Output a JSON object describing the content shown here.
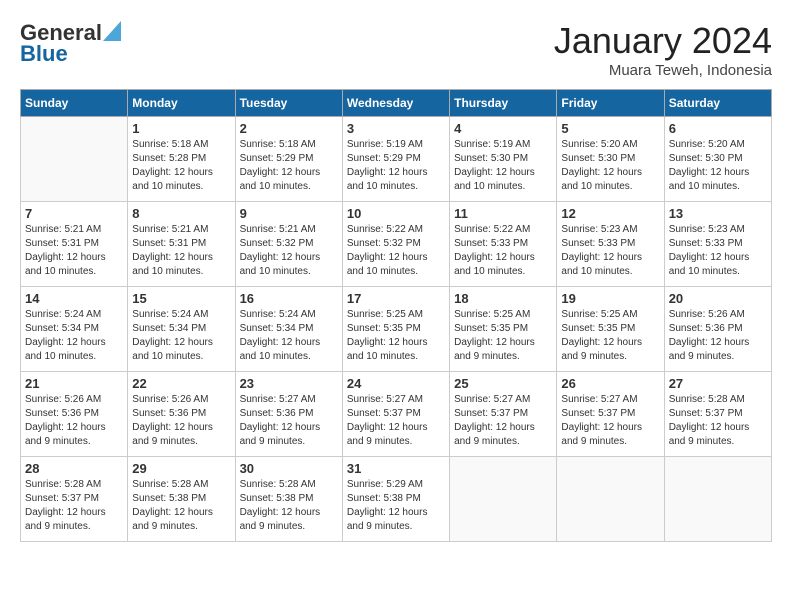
{
  "header": {
    "logo_line1": "General",
    "logo_line2": "Blue",
    "title": "January 2024",
    "subtitle": "Muara Teweh, Indonesia"
  },
  "weekdays": [
    "Sunday",
    "Monday",
    "Tuesday",
    "Wednesday",
    "Thursday",
    "Friday",
    "Saturday"
  ],
  "weeks": [
    [
      {
        "day": "",
        "info": ""
      },
      {
        "day": "1",
        "info": "Sunrise: 5:18 AM\nSunset: 5:28 PM\nDaylight: 12 hours\nand 10 minutes."
      },
      {
        "day": "2",
        "info": "Sunrise: 5:18 AM\nSunset: 5:29 PM\nDaylight: 12 hours\nand 10 minutes."
      },
      {
        "day": "3",
        "info": "Sunrise: 5:19 AM\nSunset: 5:29 PM\nDaylight: 12 hours\nand 10 minutes."
      },
      {
        "day": "4",
        "info": "Sunrise: 5:19 AM\nSunset: 5:30 PM\nDaylight: 12 hours\nand 10 minutes."
      },
      {
        "day": "5",
        "info": "Sunrise: 5:20 AM\nSunset: 5:30 PM\nDaylight: 12 hours\nand 10 minutes."
      },
      {
        "day": "6",
        "info": "Sunrise: 5:20 AM\nSunset: 5:30 PM\nDaylight: 12 hours\nand 10 minutes."
      }
    ],
    [
      {
        "day": "7",
        "info": "Sunrise: 5:21 AM\nSunset: 5:31 PM\nDaylight: 12 hours\nand 10 minutes."
      },
      {
        "day": "8",
        "info": "Sunrise: 5:21 AM\nSunset: 5:31 PM\nDaylight: 12 hours\nand 10 minutes."
      },
      {
        "day": "9",
        "info": "Sunrise: 5:21 AM\nSunset: 5:32 PM\nDaylight: 12 hours\nand 10 minutes."
      },
      {
        "day": "10",
        "info": "Sunrise: 5:22 AM\nSunset: 5:32 PM\nDaylight: 12 hours\nand 10 minutes."
      },
      {
        "day": "11",
        "info": "Sunrise: 5:22 AM\nSunset: 5:33 PM\nDaylight: 12 hours\nand 10 minutes."
      },
      {
        "day": "12",
        "info": "Sunrise: 5:23 AM\nSunset: 5:33 PM\nDaylight: 12 hours\nand 10 minutes."
      },
      {
        "day": "13",
        "info": "Sunrise: 5:23 AM\nSunset: 5:33 PM\nDaylight: 12 hours\nand 10 minutes."
      }
    ],
    [
      {
        "day": "14",
        "info": "Sunrise: 5:24 AM\nSunset: 5:34 PM\nDaylight: 12 hours\nand 10 minutes."
      },
      {
        "day": "15",
        "info": "Sunrise: 5:24 AM\nSunset: 5:34 PM\nDaylight: 12 hours\nand 10 minutes."
      },
      {
        "day": "16",
        "info": "Sunrise: 5:24 AM\nSunset: 5:34 PM\nDaylight: 12 hours\nand 10 minutes."
      },
      {
        "day": "17",
        "info": "Sunrise: 5:25 AM\nSunset: 5:35 PM\nDaylight: 12 hours\nand 10 minutes."
      },
      {
        "day": "18",
        "info": "Sunrise: 5:25 AM\nSunset: 5:35 PM\nDaylight: 12 hours\nand 9 minutes."
      },
      {
        "day": "19",
        "info": "Sunrise: 5:25 AM\nSunset: 5:35 PM\nDaylight: 12 hours\nand 9 minutes."
      },
      {
        "day": "20",
        "info": "Sunrise: 5:26 AM\nSunset: 5:36 PM\nDaylight: 12 hours\nand 9 minutes."
      }
    ],
    [
      {
        "day": "21",
        "info": "Sunrise: 5:26 AM\nSunset: 5:36 PM\nDaylight: 12 hours\nand 9 minutes."
      },
      {
        "day": "22",
        "info": "Sunrise: 5:26 AM\nSunset: 5:36 PM\nDaylight: 12 hours\nand 9 minutes."
      },
      {
        "day": "23",
        "info": "Sunrise: 5:27 AM\nSunset: 5:36 PM\nDaylight: 12 hours\nand 9 minutes."
      },
      {
        "day": "24",
        "info": "Sunrise: 5:27 AM\nSunset: 5:37 PM\nDaylight: 12 hours\nand 9 minutes."
      },
      {
        "day": "25",
        "info": "Sunrise: 5:27 AM\nSunset: 5:37 PM\nDaylight: 12 hours\nand 9 minutes."
      },
      {
        "day": "26",
        "info": "Sunrise: 5:27 AM\nSunset: 5:37 PM\nDaylight: 12 hours\nand 9 minutes."
      },
      {
        "day": "27",
        "info": "Sunrise: 5:28 AM\nSunset: 5:37 PM\nDaylight: 12 hours\nand 9 minutes."
      }
    ],
    [
      {
        "day": "28",
        "info": "Sunrise: 5:28 AM\nSunset: 5:37 PM\nDaylight: 12 hours\nand 9 minutes."
      },
      {
        "day": "29",
        "info": "Sunrise: 5:28 AM\nSunset: 5:38 PM\nDaylight: 12 hours\nand 9 minutes."
      },
      {
        "day": "30",
        "info": "Sunrise: 5:28 AM\nSunset: 5:38 PM\nDaylight: 12 hours\nand 9 minutes."
      },
      {
        "day": "31",
        "info": "Sunrise: 5:29 AM\nSunset: 5:38 PM\nDaylight: 12 hours\nand 9 minutes."
      },
      {
        "day": "",
        "info": ""
      },
      {
        "day": "",
        "info": ""
      },
      {
        "day": "",
        "info": ""
      }
    ]
  ]
}
